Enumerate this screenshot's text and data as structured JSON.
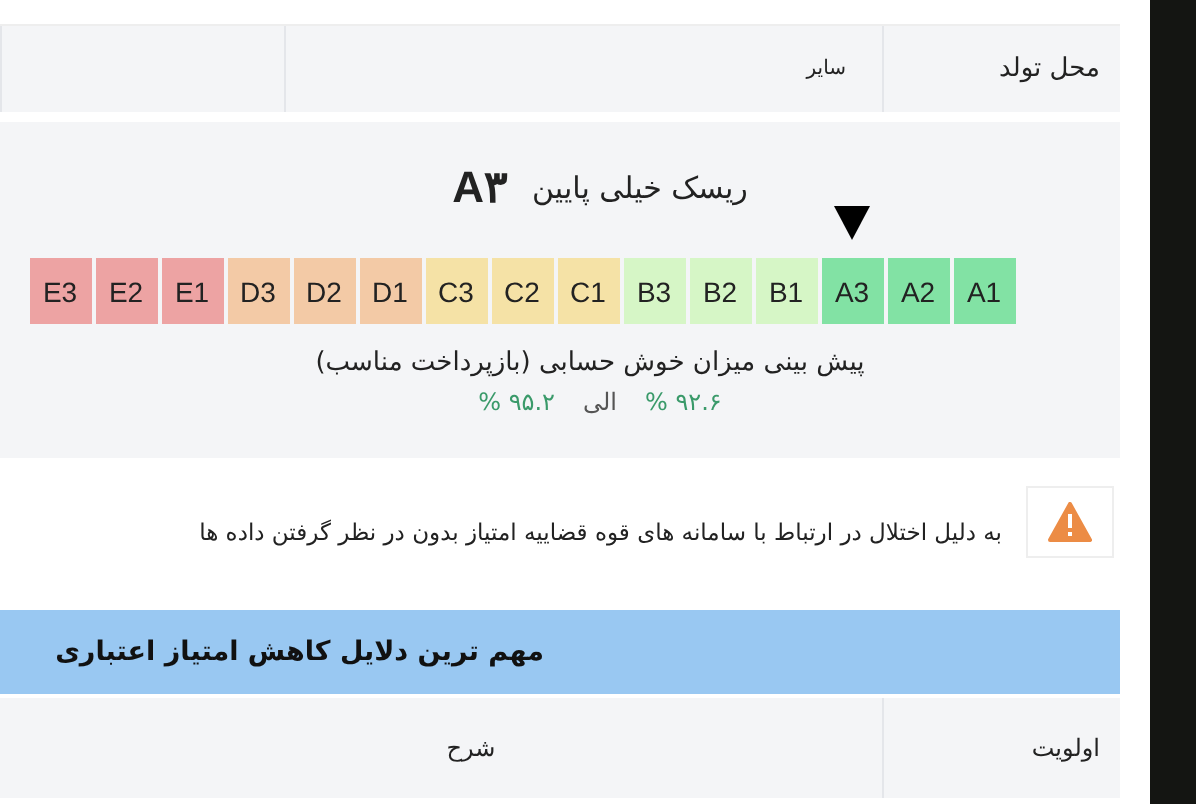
{
  "info_table": {
    "rows": [
      {
        "label": "محل تولد",
        "value": "سایر"
      }
    ]
  },
  "risk": {
    "title": "ریسک خیلی پایین",
    "grade": "A۳",
    "grades": [
      {
        "label": "A1",
        "color": "#82e2a4",
        "selected": false
      },
      {
        "label": "A2",
        "color": "#82e2a4",
        "selected": false
      },
      {
        "label": "A3",
        "color": "#82e2a4",
        "selected": true
      },
      {
        "label": "B1",
        "color": "#d6f6c6",
        "selected": false
      },
      {
        "label": "B2",
        "color": "#d6f6c6",
        "selected": false
      },
      {
        "label": "B3",
        "color": "#d6f6c6",
        "selected": false
      },
      {
        "label": "C1",
        "color": "#f5e2a6",
        "selected": false
      },
      {
        "label": "C2",
        "color": "#f5e2a6",
        "selected": false
      },
      {
        "label": "C3",
        "color": "#f5e2a6",
        "selected": false
      },
      {
        "label": "D1",
        "color": "#f3caa6",
        "selected": false
      },
      {
        "label": "D2",
        "color": "#f3caa6",
        "selected": false
      },
      {
        "label": "D3",
        "color": "#f3caa6",
        "selected": false
      },
      {
        "label": "E1",
        "color": "#eda3a3",
        "selected": false
      },
      {
        "label": "E2",
        "color": "#eda3a3",
        "selected": false
      },
      {
        "label": "E3",
        "color": "#eda3a3",
        "selected": false
      }
    ],
    "caption": "پیش بینی میزان خوش حسابی (بازپرداخت مناسب)",
    "range_from": "۹۲.۶ %",
    "range_word": "الی",
    "range_to": "۹۵.۲ %"
  },
  "warning": {
    "text": "به دلیل اختلال در ارتباط با سامانه های قوه قضاییه امتیاز بدون در نظر گرفتن داده ها"
  },
  "reasons": {
    "title": "مهم ترین دلایل کاهش امتیاز اعتباری",
    "columns": [
      "اولویت",
      "شرح"
    ]
  }
}
